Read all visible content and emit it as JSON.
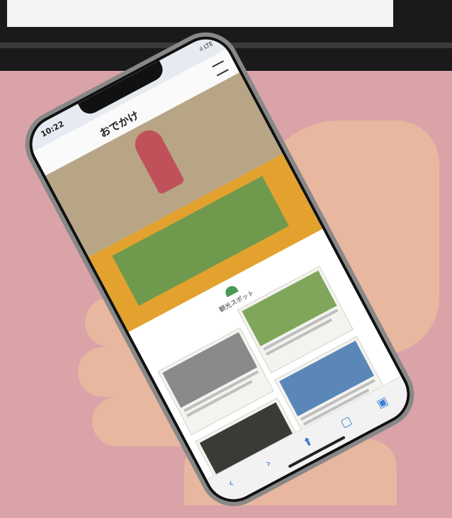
{
  "status": {
    "time": "10:22",
    "signal": "ıl LTE"
  },
  "site": {
    "title": "おでかけ"
  },
  "section": {
    "title": "観光スポット"
  },
  "colors": {
    "background": "#d9a3a8",
    "banner": "#e3a22e",
    "accent": "#4a9a55"
  },
  "nav": {
    "back": "‹",
    "forward": "›",
    "share": "⬆",
    "bookmarks": "▢",
    "tabs": "▣"
  }
}
